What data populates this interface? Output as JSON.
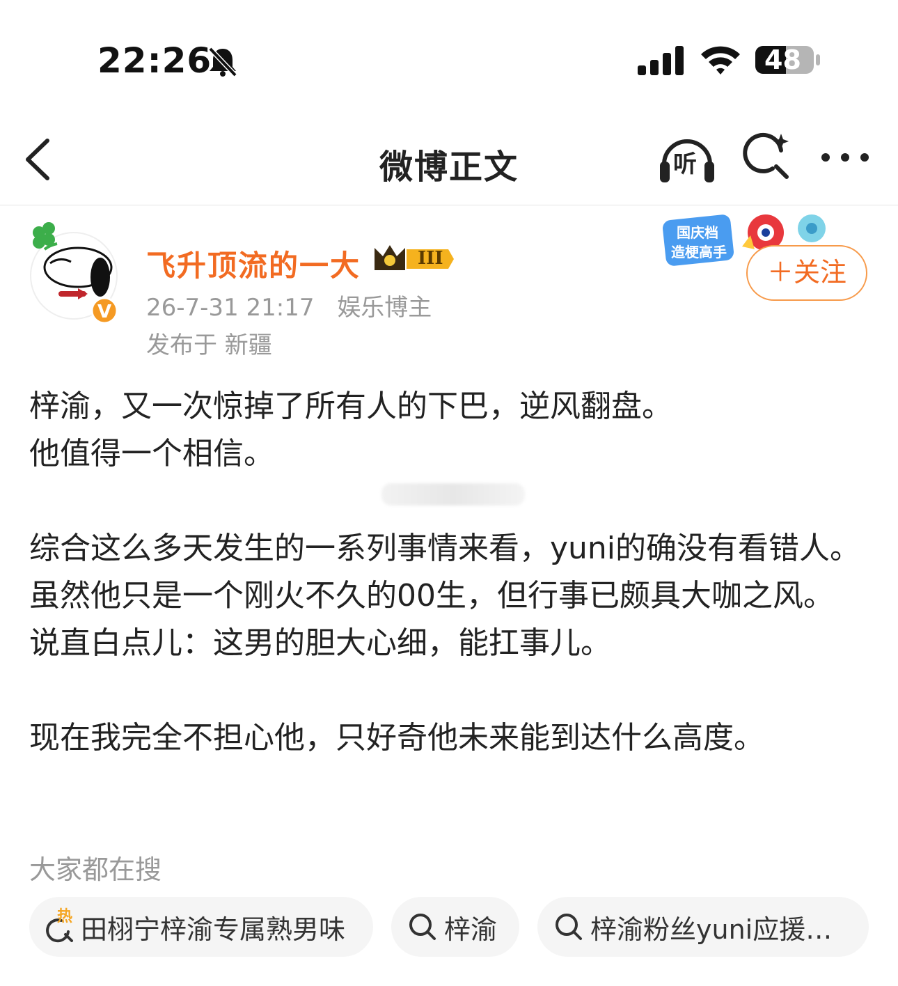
{
  "status_bar": {
    "time": "22:26",
    "battery": "48"
  },
  "nav": {
    "title": "微博正文",
    "listen_label": "听"
  },
  "author": {
    "name": "飞升顶流的一大",
    "timestamp": "26-7-31 21:17",
    "category": "娱乐博主",
    "location": "发布于 新疆",
    "vip_level": "III",
    "follow_label": "＋关注",
    "promo_text_1": "国庆档",
    "promo_text_2": "造梗高手"
  },
  "post": {
    "lines": [
      "梓渝，又一次惊掉了所有人的下巴，逆风翻盘。",
      "他值得一个相信。",
      "综合这么多天发生的一系列事情来看，yuni的确没有看错人。虽然他只是一个刚火不久的00生，但行事已颇具大咖之风。",
      "说直白点儿：这男的胆大心细，能扛事儿。",
      "现在我完全不担心他，只好奇他未来能到达什么高度。"
    ]
  },
  "search": {
    "section_title": "大家都在搜",
    "chips": [
      "田栩宁梓渝专属熟男味",
      "梓渝",
      "梓渝粉丝yuni应援…"
    ],
    "hot_badge": "热"
  },
  "colors": {
    "accent": "#f26b22",
    "follow_border": "#f79a4a",
    "muted": "#999999",
    "chip_bg": "#f5f5f5"
  }
}
